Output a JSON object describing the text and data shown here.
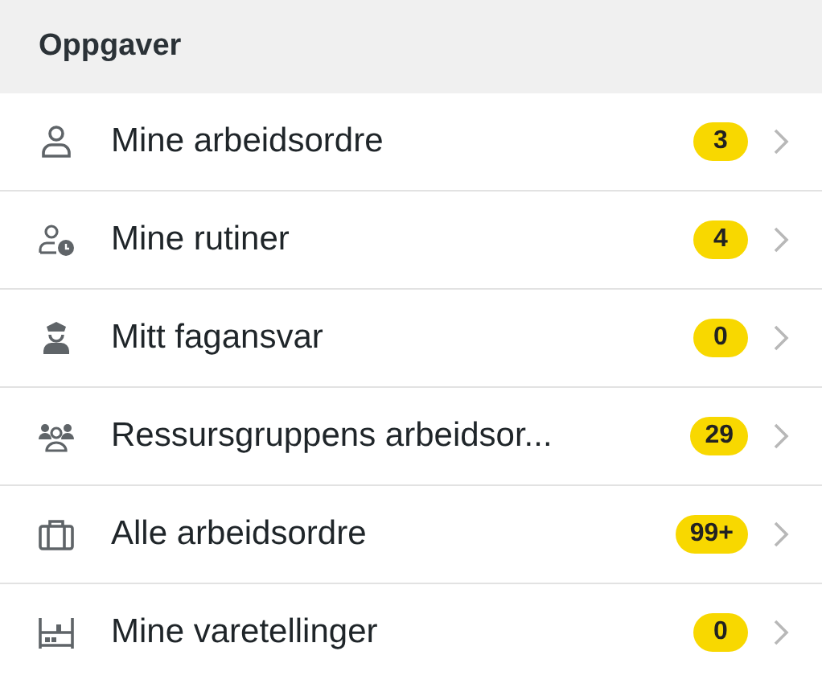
{
  "section": {
    "title": "Oppgaver"
  },
  "items": [
    {
      "label": "Mine arbeidsordre",
      "count": "3"
    },
    {
      "label": "Mine rutiner",
      "count": "4"
    },
    {
      "label": "Mitt fagansvar",
      "count": "0"
    },
    {
      "label": "Ressursgruppens arbeidsor...",
      "count": "29"
    },
    {
      "label": "Alle arbeidsordre",
      "count": "99+"
    },
    {
      "label": "Mine varetellinger",
      "count": "0"
    }
  ]
}
